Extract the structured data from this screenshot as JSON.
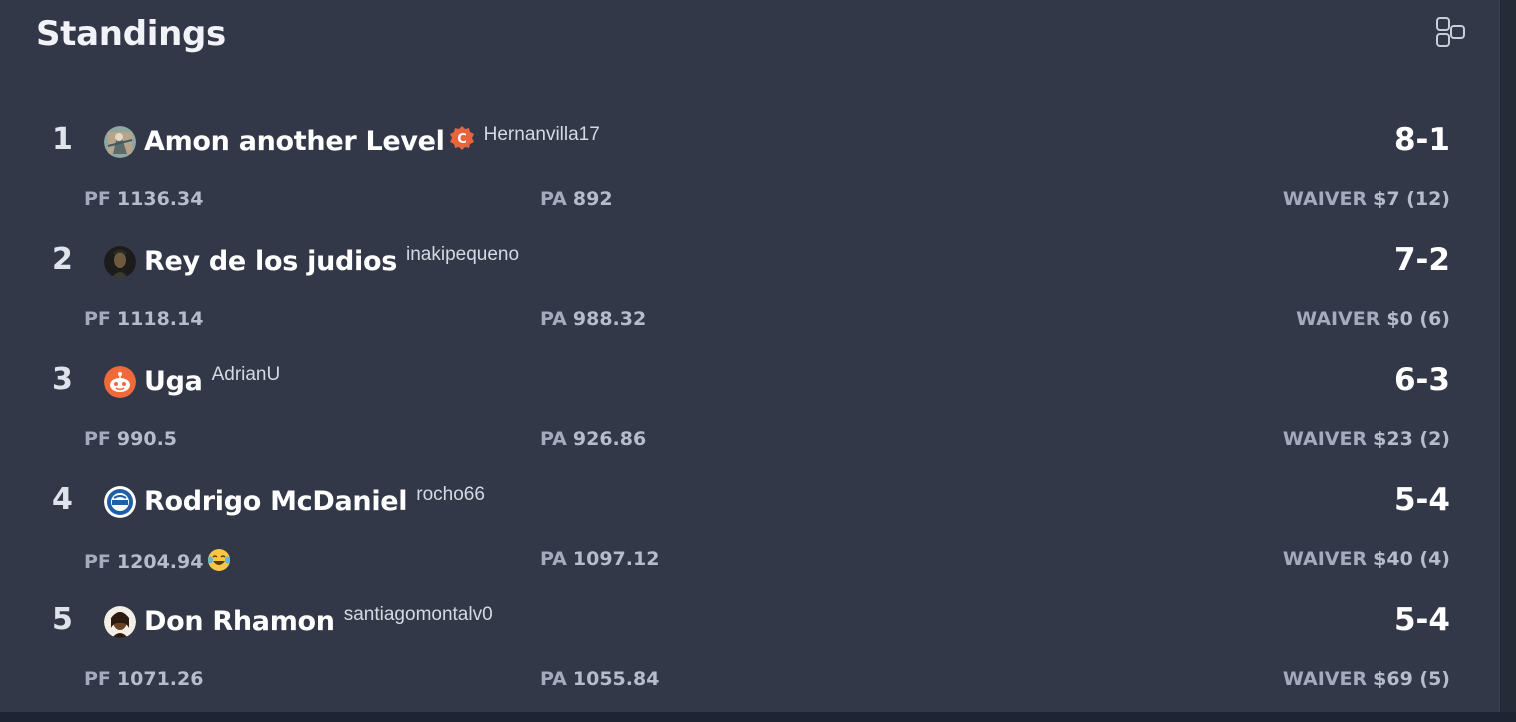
{
  "header": {
    "title": "Standings",
    "layout_icon": "layout-grid-icon"
  },
  "labels": {
    "pf": "PF",
    "pa": "PA",
    "waiver": "WAIVER"
  },
  "standings": [
    {
      "rank": "1",
      "team": "Amon another Level",
      "commissioner_badge": "C",
      "username": "Hernanvilla17",
      "record": "8-1",
      "pf": "1136.34",
      "pa": "892",
      "waiver": "$7 (12)"
    },
    {
      "rank": "2",
      "team": "Rey de los judios",
      "username": "inakipequeno",
      "record": "7-2",
      "pf": "1118.14",
      "pa": "988.32",
      "waiver": "$0 (6)"
    },
    {
      "rank": "3",
      "team": "Uga",
      "username": "AdrianU",
      "record": "6-3",
      "pf": "990.5",
      "pa": "926.86",
      "waiver": "$23 (2)"
    },
    {
      "rank": "4",
      "team": "Rodrigo McDaniel",
      "username": "rocho66",
      "record": "5-4",
      "pf": "1204.94",
      "pf_emoji": "laughing-tears-emoji",
      "pa": "1097.12",
      "waiver": "$40 (4)"
    },
    {
      "rank": "5",
      "team": "Don Rhamon",
      "username": "santiagomontalv0",
      "record": "5-4",
      "pf": "1071.26",
      "pa": "1055.84",
      "waiver": "$69 (5)"
    }
  ],
  "colors": {
    "panel": "#323848",
    "badge": "#e8643c",
    "text_muted": "#a4abbc"
  }
}
